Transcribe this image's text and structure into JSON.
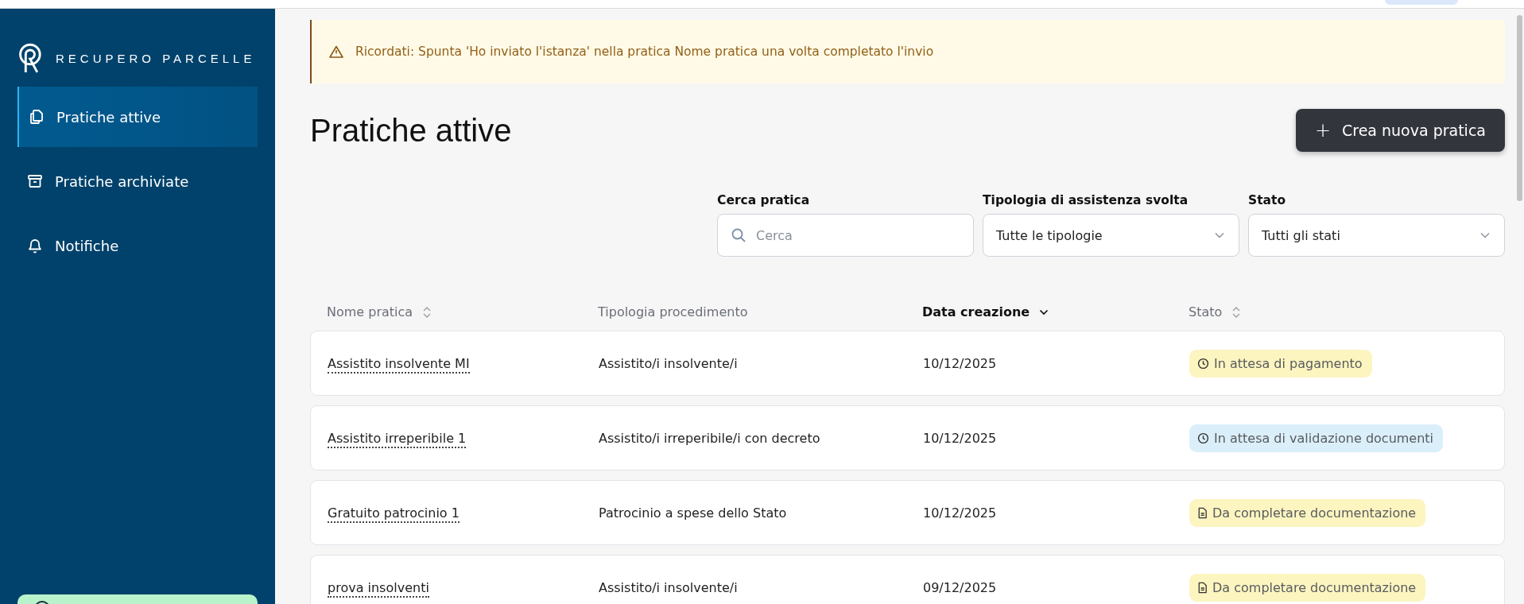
{
  "brand": {
    "name": "RECUPERO PARCELLE"
  },
  "sidebar": {
    "items": [
      {
        "label": "Pratiche attive",
        "kind": "copy",
        "selected": true
      },
      {
        "label": "Pratiche archiviate",
        "kind": "archive",
        "selected": false
      },
      {
        "label": "Notifiche",
        "kind": "bell",
        "selected": false
      }
    ]
  },
  "banner": {
    "text": "Ricordati: Spunta 'Ho inviato l'istanza' nella pratica Nome pratica una volta completato l'invio"
  },
  "page_title": "Pratiche attive",
  "create_button": {
    "icon": "+",
    "label": "Crea nuova pratica"
  },
  "filters": [
    {
      "kind": "search",
      "label": "Cerca pratica",
      "placeholder": "Cerca"
    },
    {
      "kind": "select",
      "label": "Tipologia di assistenza svolta",
      "value": "Tutte le tipologie"
    },
    {
      "kind": "select",
      "label": "Stato",
      "value": "Tutti gli stati"
    }
  ],
  "table": {
    "columns": [
      {
        "label": "Nome pratica",
        "sortable": true,
        "selected": false
      },
      {
        "label": "Tipologia procedimento",
        "sortable": false,
        "selected": false
      },
      {
        "label": "Data creazione",
        "sortable": true,
        "selected": true
      },
      {
        "label": "Stato",
        "sortable": true,
        "selected": false
      }
    ],
    "rows": [
      {
        "name": "Assistito insolvente MI",
        "type": "Assistito/i insolvente/i",
        "date": "10/12/2025",
        "status": {
          "label": "In attesa di pagamento",
          "kind": "clock",
          "color": "#fcf5c0"
        }
      },
      {
        "name": "Assistito irreperibile 1",
        "type": "Assistito/i irreperibile/i con decreto",
        "date": "10/12/2025",
        "status": {
          "label": "In attesa di validazione documenti",
          "kind": "clock",
          "color": "#dbeffa"
        }
      },
      {
        "name": "Gratuito patrocinio 1",
        "type": "Patrocinio a spese dello Stato",
        "date": "10/12/2025",
        "status": {
          "label": "Da completare documentazione",
          "kind": "doc",
          "color": "#fcf5c0"
        }
      },
      {
        "name": "prova insolventi",
        "type": "Assistito/i insolvente/i",
        "date": "09/12/2025",
        "status": {
          "label": "Da completare documentazione",
          "kind": "doc",
          "color": "#fcf5c0"
        }
      }
    ]
  }
}
